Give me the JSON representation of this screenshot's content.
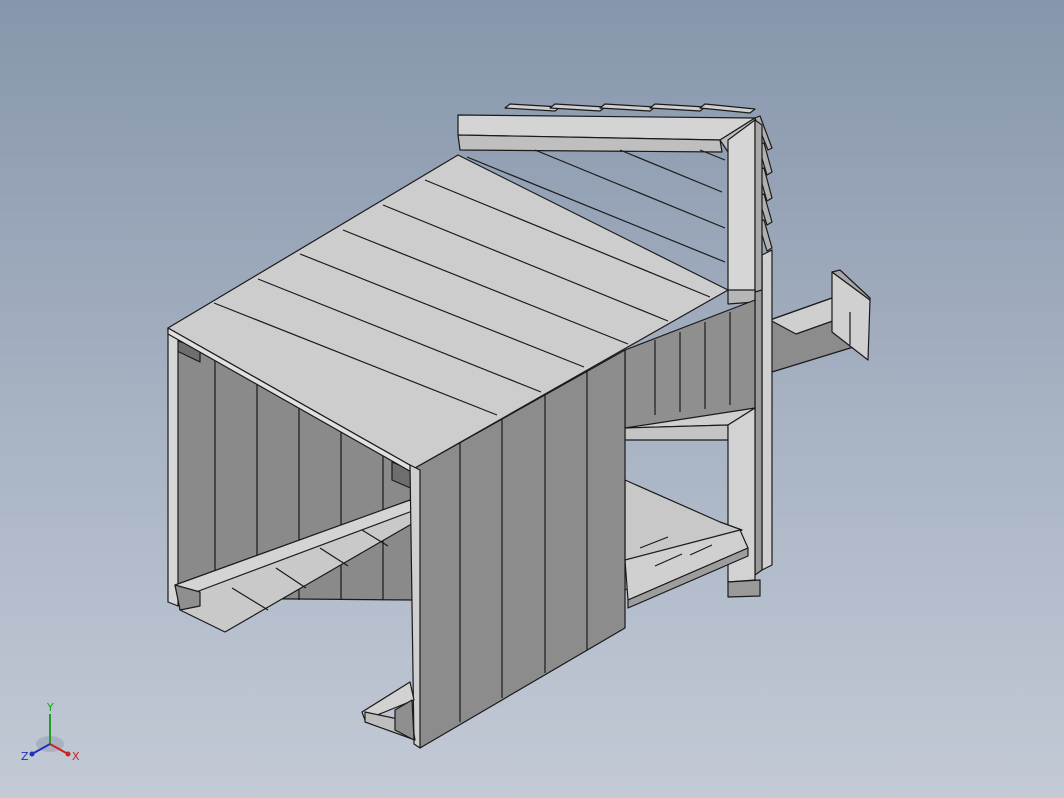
{
  "view": {
    "background_top": "#8796ac",
    "background_bottom": "#c3cad6",
    "part_color": "#c8c8c8",
    "edge_color": "#1a1a1a"
  },
  "triad": {
    "x_label": "X",
    "y_label": "Y",
    "z_label": "Z",
    "x_color": "#d02020",
    "y_color": "#20a020",
    "z_color": "#2030c0"
  }
}
